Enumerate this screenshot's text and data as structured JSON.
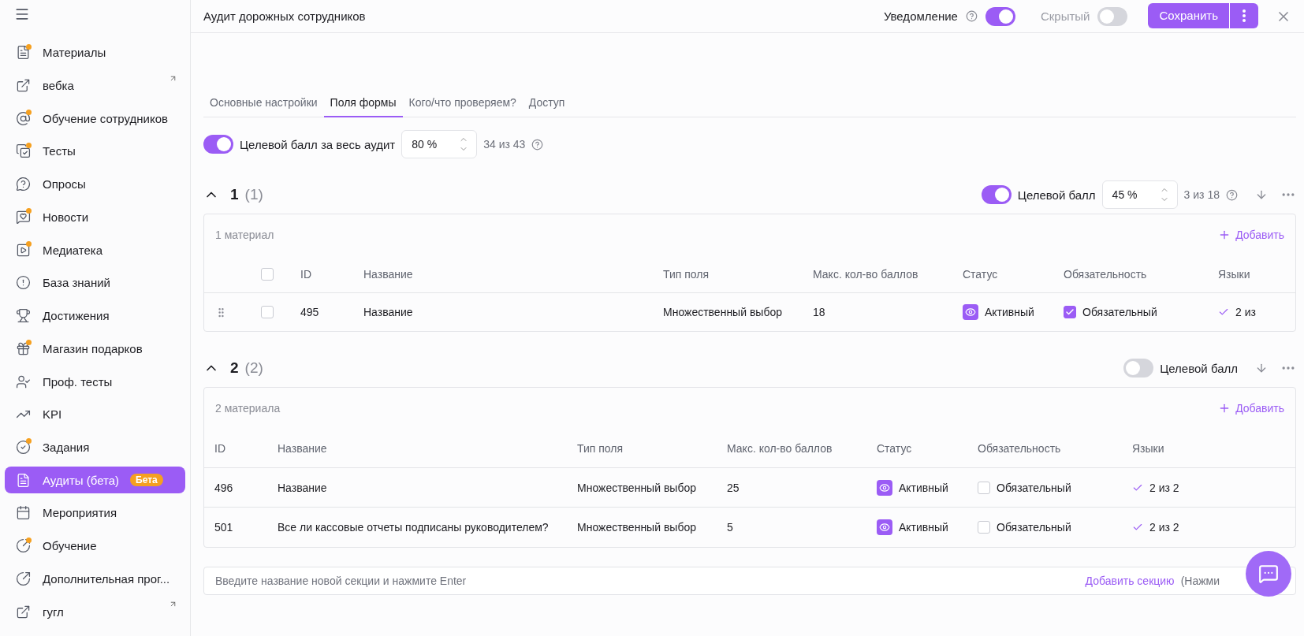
{
  "sidebar": {
    "items": [
      {
        "label": "Материалы",
        "dot": true,
        "external": false,
        "selected": false
      },
      {
        "label": "вебка",
        "dot": false,
        "external": true,
        "selected": false
      },
      {
        "label": "Обучение сотрудников",
        "dot": true,
        "external": false,
        "selected": false
      },
      {
        "label": "Тесты",
        "dot": true,
        "external": false,
        "selected": false
      },
      {
        "label": "Опросы",
        "dot": false,
        "external": false,
        "selected": false
      },
      {
        "label": "Новости",
        "dot": true,
        "external": false,
        "selected": false
      },
      {
        "label": "Медиатека",
        "dot": true,
        "external": false,
        "selected": false
      },
      {
        "label": "База знаний",
        "dot": false,
        "external": false,
        "selected": false
      },
      {
        "label": "Достижения",
        "dot": false,
        "external": false,
        "selected": false
      },
      {
        "label": "Магазин подарков",
        "dot": true,
        "external": false,
        "selected": false
      },
      {
        "label": "Проф. тесты",
        "dot": false,
        "external": false,
        "selected": false
      },
      {
        "label": "KPI",
        "dot": false,
        "external": false,
        "selected": false
      },
      {
        "label": "Задания",
        "dot": true,
        "external": false,
        "selected": false
      },
      {
        "label": "Аудиты (бета)",
        "badge": "Бета",
        "dot": false,
        "external": false,
        "selected": true
      },
      {
        "label": "Мероприятия",
        "dot": false,
        "external": false,
        "selected": false
      },
      {
        "label": "Обучение",
        "dot": true,
        "external": false,
        "selected": false
      },
      {
        "label": "Дополнительная прог...",
        "dot": false,
        "external": false,
        "selected": false
      },
      {
        "label": "гугл",
        "dot": false,
        "external": true,
        "selected": false
      }
    ]
  },
  "header": {
    "title": "Аудит дорожных сотрудников",
    "notification": {
      "label": "Уведомление",
      "on": true
    },
    "hidden": {
      "label": "Скрытый",
      "on": false
    },
    "save_button": "Сохранить"
  },
  "tabs": [
    {
      "label": "Основные настройки",
      "selected": false
    },
    {
      "label": "Поля формы",
      "selected": true
    },
    {
      "label": "Кого/что проверяем?",
      "selected": false
    },
    {
      "label": "Доступ",
      "selected": false
    }
  ],
  "target": {
    "on": true,
    "label": "Целевой балл за весь аудит",
    "value": "80 %",
    "score": "34 из 43"
  },
  "sections": [
    {
      "number": "1",
      "count": "(1)",
      "target": {
        "on": true,
        "label": "Целевой балл",
        "value": "45 %",
        "score": "3 из 18"
      },
      "materials": "1 материал",
      "add": "Добавить",
      "select_all": {
        "checked": false
      },
      "columns": [
        "ID",
        "Название",
        "Тип поля",
        "Макс. кол-во баллов",
        "Статус",
        "Обязательность",
        "Языки"
      ],
      "rows": [
        {
          "checked": false,
          "id": "495",
          "name": "Название",
          "type": "Множественный выбор",
          "max": "18",
          "status": "Активный",
          "required": true,
          "required_label": "Обязательный",
          "languages": "2 из"
        }
      ]
    },
    {
      "number": "2",
      "count": "(2)",
      "target": {
        "on": false,
        "label": "Целевой балл"
      },
      "materials": "2 материала",
      "add": "Добавить",
      "columns": [
        "ID",
        "Название",
        "Тип поля",
        "Макс. кол-во баллов",
        "Статус",
        "Обязательность",
        "Языки"
      ],
      "rows": [
        {
          "id": "496",
          "name": "Название",
          "type": "Множественный выбор",
          "max": "25",
          "status": "Активный",
          "required": false,
          "required_label": "Обязательный",
          "languages": "2 из 2"
        },
        {
          "id": "501",
          "name": "Все ли кассовые отчеты подписаны руководителем?",
          "type": "Множественный выбор",
          "max": "5",
          "status": "Активный",
          "required": false,
          "required_label": "Обязательный",
          "languages": "2 из 2"
        }
      ]
    }
  ],
  "new_section": {
    "placeholder": "Введите название новой секции и нажмите Enter",
    "add": "Добавить секцию",
    "hint": "(Нажми"
  }
}
